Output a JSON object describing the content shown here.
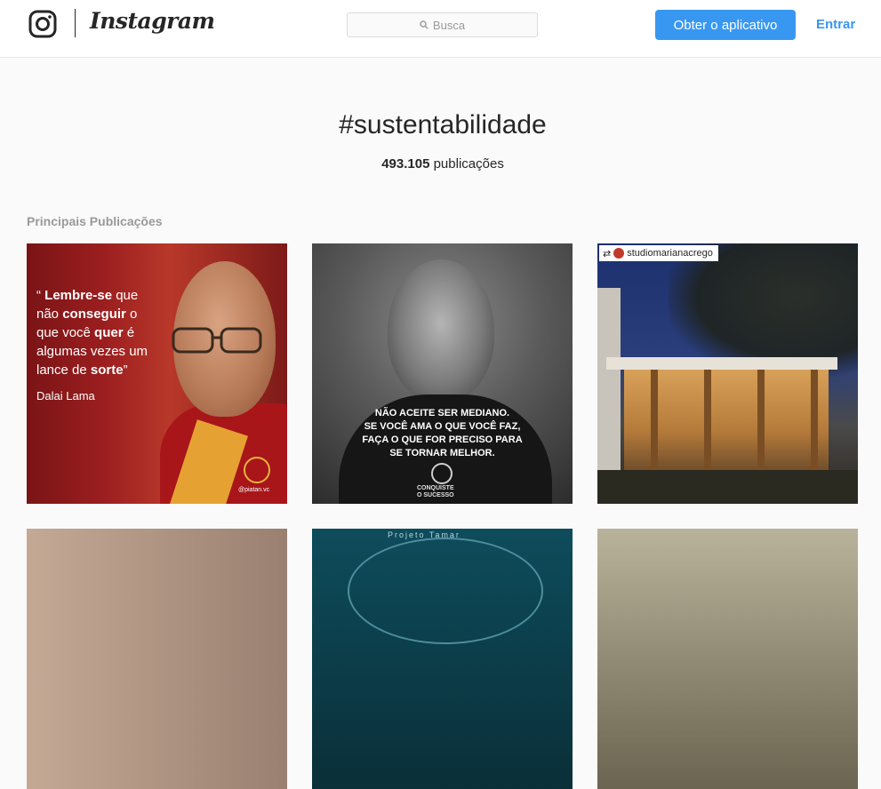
{
  "header": {
    "logo": "instagram-glyph-icon",
    "wordmark": "Instagram",
    "search": {
      "placeholder": "Busca",
      "icon": "search-icon"
    },
    "get_app_label": "Obter o aplicativo",
    "login_label": "Entrar"
  },
  "hashtag": {
    "title": "#sustentabilidade",
    "count": "493.105",
    "count_suffix": "publicações"
  },
  "section": {
    "label": "Principais Publicações"
  },
  "posts": [
    {
      "quote_lines": [
        "“ ",
        "Lembre-se",
        " que",
        "não ",
        "conseguir",
        " o",
        "que você ",
        "quer",
        " é",
        "algumas vezes um",
        "lance de ",
        "sorte",
        "”"
      ],
      "author": "Dalai Lama",
      "brand": "@piatan.vc"
    },
    {
      "caption_lines": [
        "NÃO ACEITE SER MEDIANO.",
        "SE VOCÊ AMA O QUE VOCÊ FAZ,",
        "FAÇA O QUE FOR PRECISO PARA",
        "SE TORNAR MELHOR."
      ],
      "brand_lines": [
        "CONQUISTE",
        "O SUCESSO"
      ]
    },
    {
      "repost_user": "studiomarianacrego"
    },
    {
      "text": ""
    },
    {
      "text": "Projeto Tamar"
    },
    {
      "text": ""
    }
  ],
  "colors": {
    "accent": "#3897f0",
    "text": "#262626",
    "muted": "#999999",
    "background": "#fafafa"
  }
}
